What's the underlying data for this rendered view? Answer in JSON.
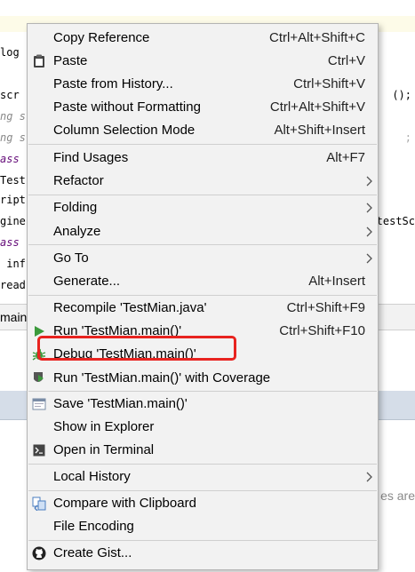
{
  "background": {
    "code_lines_left": [
      {
        "text": "log",
        "style": "normal"
      },
      {
        "text": "scr",
        "style": "normal"
      },
      {
        "text": "ng s",
        "style": "it"
      },
      {
        "text": "ng s",
        "style": "it"
      },
      {
        "text": "ass",
        "style": "pu"
      },
      {
        "text": "Test",
        "style": "normal"
      },
      {
        "text": "ript",
        "style": "normal"
      },
      {
        "text": "gine",
        "style": "normal"
      },
      {
        "text": "ass",
        "style": "pu"
      },
      {
        "text": " inf",
        "style": "normal"
      },
      {
        "text": "read",
        "style": "normal"
      }
    ],
    "code_right_1": "();",
    "code_right_2": ";",
    "code_right_3": "testSc",
    "panel_tab": "main()",
    "hint_text": "es are"
  },
  "menu": {
    "items": [
      {
        "label": "Copy Reference",
        "shortcut": "Ctrl+Alt+Shift+C",
        "icon": "",
        "submenu": false
      },
      {
        "label": "Paste",
        "shortcut": "Ctrl+V",
        "icon": "clipboard-icon",
        "submenu": false
      },
      {
        "label": "Paste from History...",
        "shortcut": "Ctrl+Shift+V",
        "icon": "",
        "submenu": false
      },
      {
        "label": "Paste without Formatting",
        "shortcut": "Ctrl+Alt+Shift+V",
        "icon": "",
        "submenu": false
      },
      {
        "label": "Column Selection Mode",
        "shortcut": "Alt+Shift+Insert",
        "icon": "",
        "submenu": false
      },
      {
        "label": "Find Usages",
        "shortcut": "Alt+F7",
        "icon": "",
        "submenu": false
      },
      {
        "label": "Refactor",
        "shortcut": "",
        "icon": "",
        "submenu": true
      },
      {
        "label": "Folding",
        "shortcut": "",
        "icon": "",
        "submenu": true
      },
      {
        "label": "Analyze",
        "shortcut": "",
        "icon": "",
        "submenu": true
      },
      {
        "label": "Go To",
        "shortcut": "",
        "icon": "",
        "submenu": true
      },
      {
        "label": "Generate...",
        "shortcut": "Alt+Insert",
        "icon": "",
        "submenu": false
      },
      {
        "label": "Recompile 'TestMian.java'",
        "shortcut": "Ctrl+Shift+F9",
        "icon": "",
        "submenu": false
      },
      {
        "label": "Run 'TestMian.main()'",
        "shortcut": "Ctrl+Shift+F10",
        "icon": "run-icon",
        "submenu": false
      },
      {
        "label": "Debug 'TestMian.main()'",
        "shortcut": "",
        "icon": "debug-bug-icon",
        "submenu": false
      },
      {
        "label": "Run 'TestMian.main()' with Coverage",
        "shortcut": "",
        "icon": "coverage-icon",
        "submenu": false
      },
      {
        "label": "Save 'TestMian.main()'",
        "shortcut": "",
        "icon": "save-config-icon",
        "submenu": false
      },
      {
        "label": "Show in Explorer",
        "shortcut": "",
        "icon": "",
        "submenu": false
      },
      {
        "label": "Open in Terminal",
        "shortcut": "",
        "icon": "terminal-icon",
        "submenu": false
      },
      {
        "label": "Local History",
        "shortcut": "",
        "icon": "",
        "submenu": true
      },
      {
        "label": "Compare with Clipboard",
        "shortcut": "",
        "icon": "compare-icon",
        "submenu": false
      },
      {
        "label": "File Encoding",
        "shortcut": "",
        "icon": "",
        "submenu": false
      },
      {
        "label": "Create Gist...",
        "shortcut": "",
        "icon": "github-icon",
        "submenu": false
      }
    ]
  },
  "colors": {
    "menu_bg": "#f2f2f2",
    "highlight_box": "#e8231f",
    "run_green": "#3c9a3c"
  }
}
